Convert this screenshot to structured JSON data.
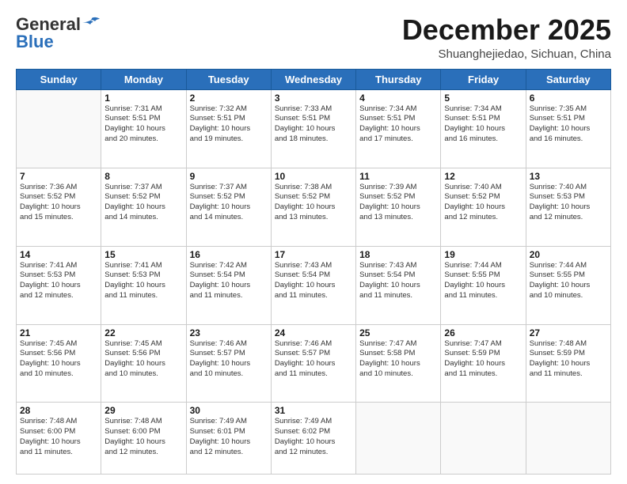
{
  "logo": {
    "general": "General",
    "blue": "Blue"
  },
  "title": "December 2025",
  "subtitle": "Shuanghejiedao, Sichuan, China",
  "days_of_week": [
    "Sunday",
    "Monday",
    "Tuesday",
    "Wednesday",
    "Thursday",
    "Friday",
    "Saturday"
  ],
  "weeks": [
    [
      {
        "day": "",
        "info": ""
      },
      {
        "day": "1",
        "info": "Sunrise: 7:31 AM\nSunset: 5:51 PM\nDaylight: 10 hours\nand 20 minutes."
      },
      {
        "day": "2",
        "info": "Sunrise: 7:32 AM\nSunset: 5:51 PM\nDaylight: 10 hours\nand 19 minutes."
      },
      {
        "day": "3",
        "info": "Sunrise: 7:33 AM\nSunset: 5:51 PM\nDaylight: 10 hours\nand 18 minutes."
      },
      {
        "day": "4",
        "info": "Sunrise: 7:34 AM\nSunset: 5:51 PM\nDaylight: 10 hours\nand 17 minutes."
      },
      {
        "day": "5",
        "info": "Sunrise: 7:34 AM\nSunset: 5:51 PM\nDaylight: 10 hours\nand 16 minutes."
      },
      {
        "day": "6",
        "info": "Sunrise: 7:35 AM\nSunset: 5:51 PM\nDaylight: 10 hours\nand 16 minutes."
      }
    ],
    [
      {
        "day": "7",
        "info": "Sunrise: 7:36 AM\nSunset: 5:52 PM\nDaylight: 10 hours\nand 15 minutes."
      },
      {
        "day": "8",
        "info": "Sunrise: 7:37 AM\nSunset: 5:52 PM\nDaylight: 10 hours\nand 14 minutes."
      },
      {
        "day": "9",
        "info": "Sunrise: 7:37 AM\nSunset: 5:52 PM\nDaylight: 10 hours\nand 14 minutes."
      },
      {
        "day": "10",
        "info": "Sunrise: 7:38 AM\nSunset: 5:52 PM\nDaylight: 10 hours\nand 13 minutes."
      },
      {
        "day": "11",
        "info": "Sunrise: 7:39 AM\nSunset: 5:52 PM\nDaylight: 10 hours\nand 13 minutes."
      },
      {
        "day": "12",
        "info": "Sunrise: 7:40 AM\nSunset: 5:52 PM\nDaylight: 10 hours\nand 12 minutes."
      },
      {
        "day": "13",
        "info": "Sunrise: 7:40 AM\nSunset: 5:53 PM\nDaylight: 10 hours\nand 12 minutes."
      }
    ],
    [
      {
        "day": "14",
        "info": "Sunrise: 7:41 AM\nSunset: 5:53 PM\nDaylight: 10 hours\nand 12 minutes."
      },
      {
        "day": "15",
        "info": "Sunrise: 7:41 AM\nSunset: 5:53 PM\nDaylight: 10 hours\nand 11 minutes."
      },
      {
        "day": "16",
        "info": "Sunrise: 7:42 AM\nSunset: 5:54 PM\nDaylight: 10 hours\nand 11 minutes."
      },
      {
        "day": "17",
        "info": "Sunrise: 7:43 AM\nSunset: 5:54 PM\nDaylight: 10 hours\nand 11 minutes."
      },
      {
        "day": "18",
        "info": "Sunrise: 7:43 AM\nSunset: 5:54 PM\nDaylight: 10 hours\nand 11 minutes."
      },
      {
        "day": "19",
        "info": "Sunrise: 7:44 AM\nSunset: 5:55 PM\nDaylight: 10 hours\nand 11 minutes."
      },
      {
        "day": "20",
        "info": "Sunrise: 7:44 AM\nSunset: 5:55 PM\nDaylight: 10 hours\nand 10 minutes."
      }
    ],
    [
      {
        "day": "21",
        "info": "Sunrise: 7:45 AM\nSunset: 5:56 PM\nDaylight: 10 hours\nand 10 minutes."
      },
      {
        "day": "22",
        "info": "Sunrise: 7:45 AM\nSunset: 5:56 PM\nDaylight: 10 hours\nand 10 minutes."
      },
      {
        "day": "23",
        "info": "Sunrise: 7:46 AM\nSunset: 5:57 PM\nDaylight: 10 hours\nand 10 minutes."
      },
      {
        "day": "24",
        "info": "Sunrise: 7:46 AM\nSunset: 5:57 PM\nDaylight: 10 hours\nand 11 minutes."
      },
      {
        "day": "25",
        "info": "Sunrise: 7:47 AM\nSunset: 5:58 PM\nDaylight: 10 hours\nand 10 minutes."
      },
      {
        "day": "26",
        "info": "Sunrise: 7:47 AM\nSunset: 5:59 PM\nDaylight: 10 hours\nand 11 minutes."
      },
      {
        "day": "27",
        "info": "Sunrise: 7:48 AM\nSunset: 5:59 PM\nDaylight: 10 hours\nand 11 minutes."
      }
    ],
    [
      {
        "day": "28",
        "info": "Sunrise: 7:48 AM\nSunset: 6:00 PM\nDaylight: 10 hours\nand 11 minutes."
      },
      {
        "day": "29",
        "info": "Sunrise: 7:48 AM\nSunset: 6:00 PM\nDaylight: 10 hours\nand 12 minutes."
      },
      {
        "day": "30",
        "info": "Sunrise: 7:49 AM\nSunset: 6:01 PM\nDaylight: 10 hours\nand 12 minutes."
      },
      {
        "day": "31",
        "info": "Sunrise: 7:49 AM\nSunset: 6:02 PM\nDaylight: 10 hours\nand 12 minutes."
      },
      {
        "day": "",
        "info": ""
      },
      {
        "day": "",
        "info": ""
      },
      {
        "day": "",
        "info": ""
      }
    ]
  ]
}
